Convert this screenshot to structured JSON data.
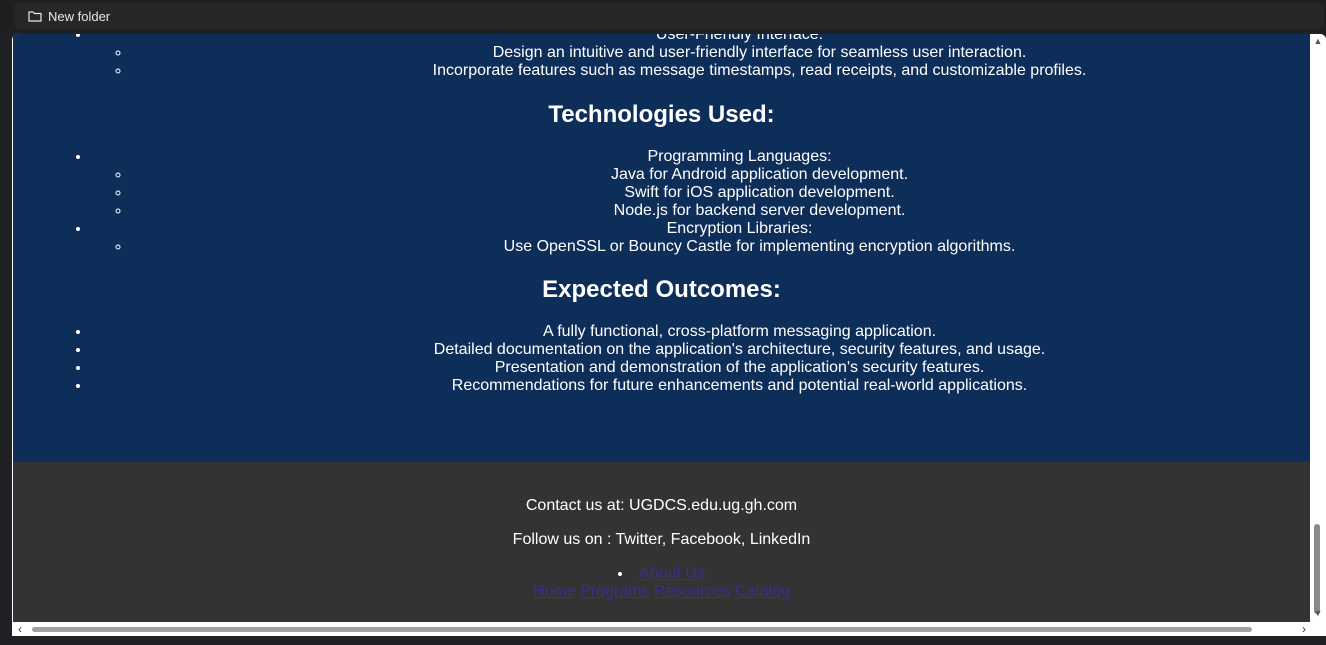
{
  "bookmarks": {
    "folder_label": "New folder"
  },
  "top_section": {
    "item_label": "User-Friendly Interface:",
    "subitems": [
      "Design an intuitive and user-friendly interface for seamless user interaction.",
      "Incorporate features such as message timestamps, read receipts, and customizable profiles."
    ]
  },
  "technologies": {
    "heading": "Technologies Used:",
    "groups": [
      {
        "label": "Programming Languages:",
        "items": [
          "Java for Android application development.",
          "Swift for iOS application development.",
          "Node.js for backend server development."
        ]
      },
      {
        "label": "Encryption Libraries:",
        "items": [
          "Use OpenSSL or Bouncy Castle for implementing encryption algorithms."
        ]
      }
    ]
  },
  "outcomes": {
    "heading": "Expected Outcomes:",
    "items": [
      "A fully functional, cross-platform messaging application.",
      "Detailed documentation on the application's architecture, security features, and usage.",
      "Presentation and demonstration of the application's security features.",
      "Recommendations for future enhancements and potential real-world applications."
    ]
  },
  "footer": {
    "contact": "Contact us at: UGDCS.edu.ug.gh.com",
    "follow": "Follow us on : Twitter, Facebook, LinkedIn",
    "about_link": "About Us",
    "nav_links": [
      "Home",
      "Programs",
      "Resources",
      "Catalog"
    ]
  }
}
